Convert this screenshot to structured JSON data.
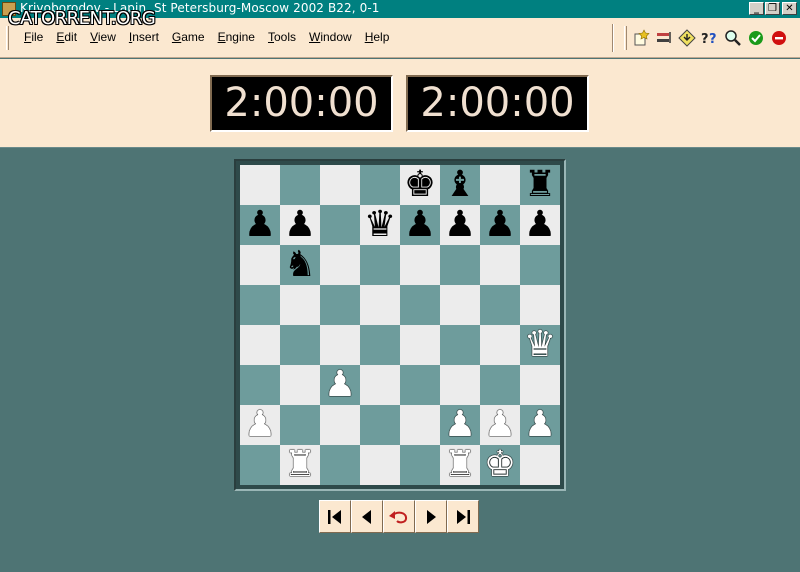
{
  "window": {
    "title": "Krivoborodov - Lapin, St Petersburg-Moscow 2002  B22, 0-1",
    "watermark": "CATORRENT.ORG",
    "controls": {
      "minimize": "_",
      "restore": "❐",
      "close": "✕"
    }
  },
  "menu": [
    {
      "key": "file",
      "u": "F",
      "rest": "ile"
    },
    {
      "key": "edit",
      "u": "E",
      "rest": "dit"
    },
    {
      "key": "view",
      "u": "V",
      "rest": "iew"
    },
    {
      "key": "insert",
      "u": "I",
      "rest": "nsert"
    },
    {
      "key": "game",
      "u": "G",
      "rest": "ame"
    },
    {
      "key": "engine",
      "u": "E",
      "rest": "ngine"
    },
    {
      "key": "tools",
      "u": "T",
      "rest": "ools"
    },
    {
      "key": "window",
      "u": "W",
      "rest": "indow"
    },
    {
      "key": "help",
      "u": "H",
      "rest": "elp"
    }
  ],
  "toolbar": {
    "icons": [
      "new-game-icon",
      "flip-board-icon",
      "analysis-icon",
      "hint-icon",
      "search-icon",
      "ok-icon",
      "stop-icon"
    ],
    "colors": {
      "ok": "#1a9a1a",
      "stop": "#d01010",
      "accent": "#e8c020"
    }
  },
  "clocks": {
    "white": "2:00:00",
    "black": "2:00:00"
  },
  "board": {
    "light_color": "#ececec",
    "dark_color": "#6e9c9c",
    "ranks": [
      [
        "",
        "",
        "",
        "",
        "bk",
        "bb",
        "",
        "br"
      ],
      [
        "bp",
        "bp",
        "",
        "bq",
        "bp",
        "bp",
        "bp",
        "bp"
      ],
      [
        "",
        "bn",
        "",
        "",
        "",
        "",
        "",
        ""
      ],
      [
        "",
        "",
        "",
        "",
        "",
        "",
        "",
        ""
      ],
      [
        "",
        "",
        "",
        "",
        "",
        "",
        "",
        "wq"
      ],
      [
        "",
        "",
        "wp",
        "",
        "",
        "",
        "",
        ""
      ],
      [
        "wp",
        "",
        "",
        "",
        "",
        "wp",
        "wp",
        "wp"
      ],
      [
        "",
        "wr",
        "",
        "",
        "",
        "wr",
        "wk",
        ""
      ]
    ]
  },
  "navigation": {
    "buttons": [
      "first-move-icon",
      "previous-move-icon",
      "takeback-icon",
      "next-move-icon",
      "last-move-icon"
    ]
  }
}
